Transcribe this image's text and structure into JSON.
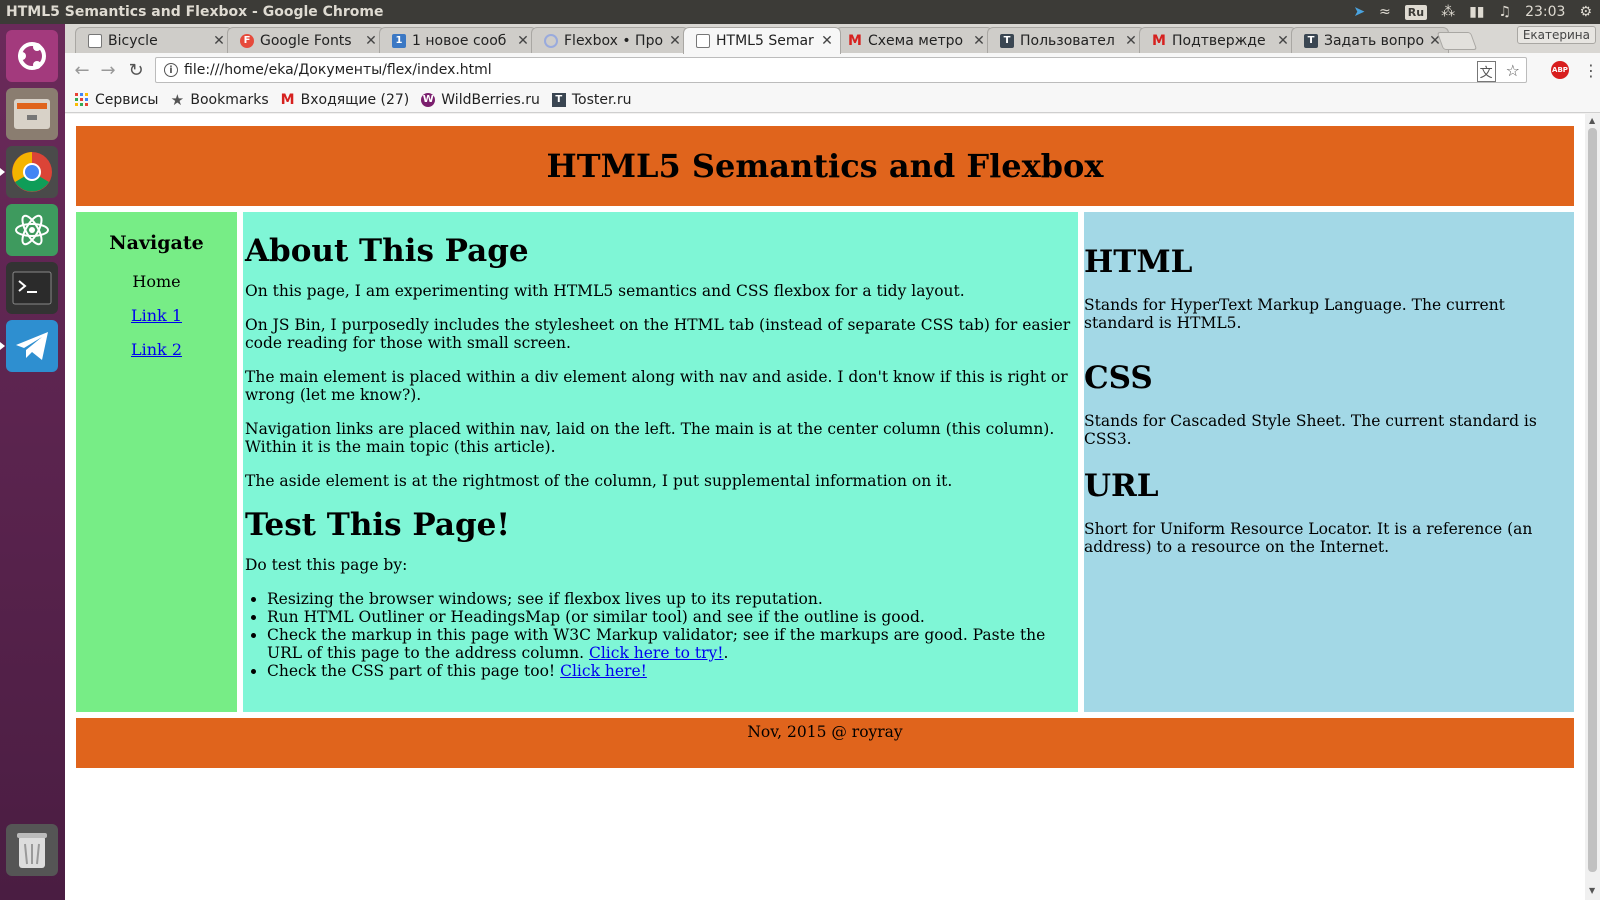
{
  "window": {
    "title": "HTML5 Semantics and Flexbox - Google Chrome"
  },
  "system": {
    "keyboard": "Ru",
    "time": "23:03"
  },
  "tabs": [
    {
      "label": "Bicycle",
      "icon": "page-icon"
    },
    {
      "label": "Google Fonts",
      "icon": "google-fonts-icon"
    },
    {
      "label": "1 новое сооб",
      "icon": "badge-icon"
    },
    {
      "label": "Flexbox • Про",
      "icon": "flexbox-icon"
    },
    {
      "label": "HTML5 Semar",
      "icon": "page-icon"
    },
    {
      "label": "Схема метро",
      "icon": "metro-icon"
    },
    {
      "label": "Пользовател",
      "icon": "toster-icon"
    },
    {
      "label": "Подтвержде",
      "icon": "gmail-icon"
    },
    {
      "label": "Задать вопро",
      "icon": "toster-icon"
    }
  ],
  "profile": "Екатерина",
  "address": {
    "url": "file:///home/eka/Документы/flex/index.html"
  },
  "bookmarks": [
    {
      "label": "Сервисы",
      "icon": "apps-icon"
    },
    {
      "label": "Bookmarks",
      "icon": "star-icon"
    },
    {
      "label": "Входящие (27)",
      "icon": "gmail-icon"
    },
    {
      "label": "WildBerries.ru",
      "icon": "wildberries-icon"
    },
    {
      "label": "Toster.ru",
      "icon": "toster-icon"
    }
  ],
  "page": {
    "header": "HTML5 Semantics and Flexbox",
    "nav": {
      "title": "Navigate",
      "home": "Home",
      "link1": "Link 1",
      "link2": "Link 2"
    },
    "main": {
      "h_about": "About This Page",
      "p1": "On this page, I am experimenting with HTML5 semantics and CSS flexbox for a tidy layout.",
      "p2": "On JS Bin, I purposedly includes the stylesheet on the HTML tab (instead of separate CSS tab) for easier code reading for those with small screen.",
      "p3": "The main element is placed within a div element along with nav and aside. I don't know if this is right or wrong (let me know?).",
      "p4": "Navigation links are placed within nav, laid on the left. The main is at the center column (this column). Within it is the main topic (this article).",
      "p5": "The aside element is at the rightmost of the column, I put supplemental information on it.",
      "h_test": "Test This Page!",
      "test_intro": "Do test this page by:",
      "li1": "Resizing the browser windows; see if flexbox lives up to its reputation.",
      "li2": "Run HTML Outliner or HeadingsMap (or similar tool) and see if the outline is good.",
      "li3": "Check the markup in this page with W3C Markup validator; see if the markups are good. Paste the URL of this page to the address column.",
      "li3_link": "Click here to try!",
      "li3_end": ".",
      "li4": "Check the CSS part of this page too!",
      "li4_link": "Click here!"
    },
    "aside": {
      "h1": "HTML",
      "p1": "Stands for HyperText Markup Language. The current standard is HTML5.",
      "h2": "CSS",
      "p2": "Stands for Cascaded Style Sheet. The current standard is CSS3.",
      "h3": "URL",
      "p3": "Short for Uniform Resource Locator. It is a reference (an address) to a resource on the Internet."
    },
    "footer": "Nov, 2015 @ royray"
  },
  "colors": {
    "header": "#e0641c",
    "nav": "#77ed86",
    "main": "#7ff6d6",
    "aside": "#a3d8e6"
  }
}
